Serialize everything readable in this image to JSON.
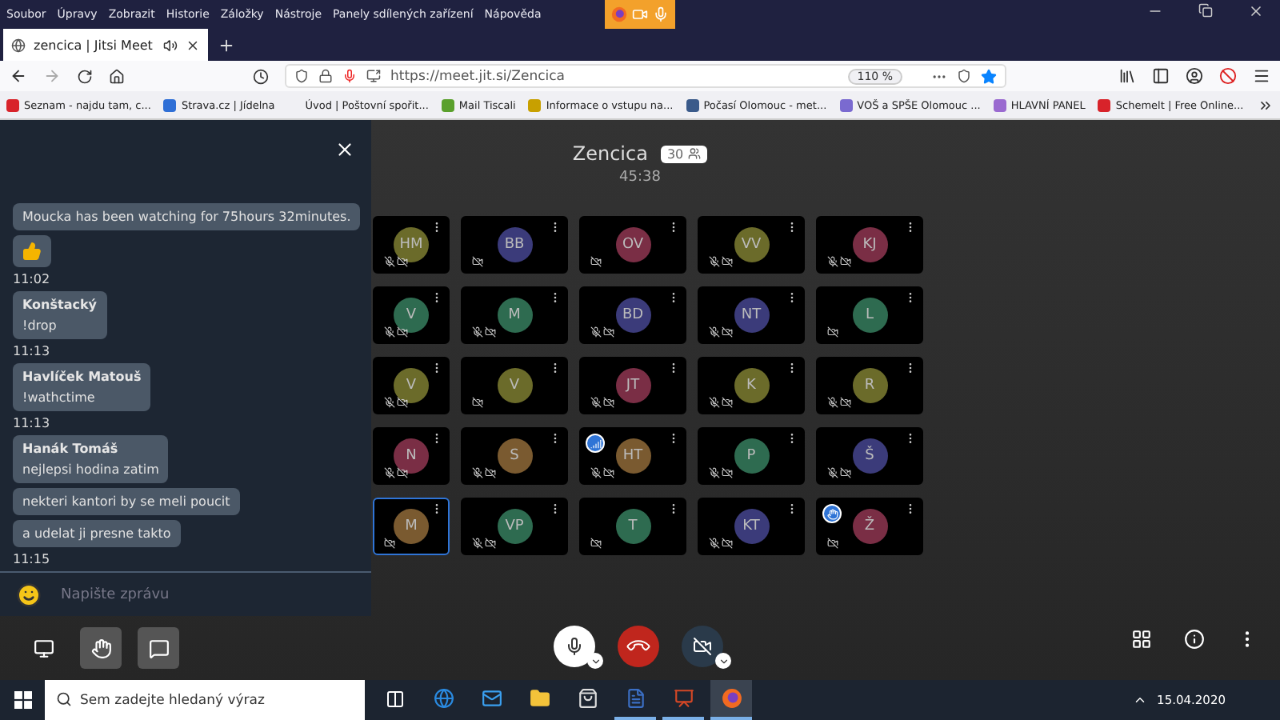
{
  "menu_bar": [
    "Soubor",
    "Úpravy",
    "Zobrazit",
    "Historie",
    "Záložky",
    "Nástroje",
    "Panely sdílených zařízení",
    "Nápověda"
  ],
  "tab": {
    "title": "zencica | Jitsi Meet",
    "playing_audio": true
  },
  "address_bar": {
    "url": "https://meet.jit.si/Zencica",
    "zoom": "110 %",
    "bookmarked": true
  },
  "bookmarks": [
    {
      "label": "Seznam - najdu tam, c...",
      "color": "#d8232a"
    },
    {
      "label": "Strava.cz | Jídelna",
      "color": "#2f6fd6"
    },
    {
      "label": "Úvod | Poštovní spořit...",
      "color": "#f0f0f4"
    },
    {
      "label": "Mail Tiscali",
      "color": "#5aa02c"
    },
    {
      "label": "Informace o vstupu na...",
      "color": "#c8a000"
    },
    {
      "label": "Počasí Olomouc - met...",
      "color": "#3a5a8a"
    },
    {
      "label": "VOŠ a SPŠE Olomouc ...",
      "color": "#7a6ad0"
    },
    {
      "label": "HLAVNÍ PANEL",
      "color": "#9a6ad0"
    },
    {
      "label": "Schemelt | Free Online...",
      "color": "#d8232a"
    }
  ],
  "chat": {
    "groups": [
      {
        "messages": [
          {
            "kind": "text",
            "text": "Moucka has been watching for 75hours 32minutes."
          },
          {
            "kind": "thumbs_up"
          }
        ],
        "time": "11:02"
      },
      {
        "sender": "Konštacký",
        "messages": [
          {
            "kind": "text",
            "text": "!drop"
          }
        ],
        "time": "11:13"
      },
      {
        "sender": "Havlíček Matouš",
        "messages": [
          {
            "kind": "text",
            "text": "!wathctime"
          }
        ],
        "time": "11:13"
      },
      {
        "sender": "Hanák Tomáš",
        "messages": [
          {
            "kind": "text",
            "text": "nejlepsi hodina zatim"
          },
          {
            "kind": "text",
            "text": "nekteri kantori by se meli poucit"
          },
          {
            "kind": "text",
            "text": "a udelat ji presne takto"
          }
        ],
        "time": "11:15"
      }
    ],
    "placeholder": "Napište zprávu"
  },
  "conference": {
    "title": "Zencica",
    "participant_count": "30",
    "timer": "45:38"
  },
  "tiles": [
    {
      "initials": "HM",
      "color": "#6b6b2a",
      "mic_muted": true,
      "selected": false
    },
    {
      "initials": "BB",
      "color": "#3b3b7a",
      "mic_muted": false,
      "selected": false
    },
    {
      "initials": "OV",
      "color": "#7a2e45",
      "mic_muted": false,
      "selected": false
    },
    {
      "initials": "VV",
      "color": "#6b6b2a",
      "mic_muted": true,
      "selected": false
    },
    {
      "initials": "KJ",
      "color": "#7a2e45",
      "mic_muted": true,
      "selected": false
    },
    {
      "initials": "V",
      "color": "#2e6b50",
      "mic_muted": true,
      "selected": false
    },
    {
      "initials": "M",
      "color": "#2e6b50",
      "mic_muted": true,
      "selected": false
    },
    {
      "initials": "BD",
      "color": "#3b3b7a",
      "mic_muted": true,
      "selected": false
    },
    {
      "initials": "NT",
      "color": "#3b3b7a",
      "mic_muted": true,
      "selected": false
    },
    {
      "initials": "L",
      "color": "#2e6b50",
      "mic_muted": false,
      "selected": false
    },
    {
      "initials": "V",
      "color": "#6b6b2a",
      "mic_muted": true,
      "selected": false
    },
    {
      "initials": "V",
      "color": "#6b6b2a",
      "mic_muted": false,
      "selected": false
    },
    {
      "initials": "JT",
      "color": "#7a2e45",
      "mic_muted": true,
      "selected": false
    },
    {
      "initials": "K",
      "color": "#6b6b2a",
      "mic_muted": true,
      "selected": false
    },
    {
      "initials": "R",
      "color": "#6b6b2a",
      "mic_muted": true,
      "selected": false
    },
    {
      "initials": "N",
      "color": "#7a2e45",
      "mic_muted": true,
      "selected": false
    },
    {
      "initials": "S",
      "color": "#7a5a30",
      "mic_muted": true,
      "selected": false
    },
    {
      "initials": "HT",
      "color": "#7a5a30",
      "mic_muted": true,
      "selected": false,
      "connection_badge": true
    },
    {
      "initials": "P",
      "color": "#2e6b50",
      "mic_muted": true,
      "selected": false
    },
    {
      "initials": "Š",
      "color": "#3b3b7a",
      "mic_muted": true,
      "selected": false
    },
    {
      "initials": "M",
      "color": "#7a5a30",
      "mic_muted": false,
      "selected": true
    },
    {
      "initials": "VP",
      "color": "#2e6b50",
      "mic_muted": true,
      "selected": false
    },
    {
      "initials": "T",
      "color": "#2e6b50",
      "mic_muted": false,
      "selected": false
    },
    {
      "initials": "KT",
      "color": "#3b3b7a",
      "mic_muted": true,
      "selected": false
    },
    {
      "initials": "Ž",
      "color": "#7a2e45",
      "mic_muted": false,
      "selected": false,
      "hand_raised": true
    }
  ],
  "toolbar": {
    "raise_hand_on": true,
    "mic_on": true,
    "camera_on": false
  },
  "taskbar": {
    "search_placeholder": "Sem zadejte hledaný výraz",
    "apps": [
      {
        "kind": "task_view",
        "open": false,
        "selected": false
      },
      {
        "kind": "edge",
        "open": false,
        "selected": false
      },
      {
        "kind": "mail",
        "open": false,
        "selected": false
      },
      {
        "kind": "explorer",
        "open": false,
        "selected": false
      },
      {
        "kind": "store",
        "open": false,
        "selected": false
      },
      {
        "kind": "word",
        "open": true,
        "selected": false
      },
      {
        "kind": "powerpoint",
        "open": true,
        "selected": false
      },
      {
        "kind": "firefox",
        "open": true,
        "selected": true
      }
    ],
    "date": "15.04.2020"
  }
}
